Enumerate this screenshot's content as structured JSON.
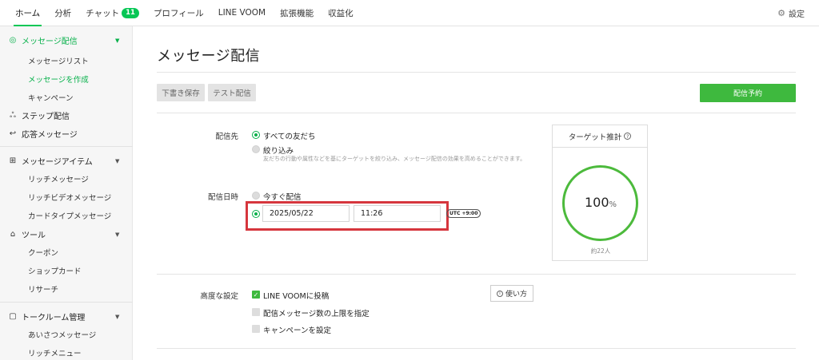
{
  "topnav": {
    "tabs": [
      {
        "label": "ホーム"
      },
      {
        "label": "分析"
      },
      {
        "label": "チャット",
        "badge": "11"
      },
      {
        "label": "プロフィール"
      },
      {
        "label": "LINE VOOM"
      },
      {
        "label": "拡張機能"
      },
      {
        "label": "収益化"
      }
    ],
    "settings_label": "設定"
  },
  "sidebar": {
    "sections": [
      {
        "label": "メッセージ配信",
        "icon": "broadcast-icon"
      },
      {
        "label": "ステップ配信",
        "icon": "step-tree-icon"
      },
      {
        "label": "応答メッセージ",
        "icon": "reply-icon"
      },
      {
        "label": "メッセージアイテム",
        "icon": "plus-box-icon"
      },
      {
        "label": "ツール",
        "icon": "store-icon"
      },
      {
        "label": "トークルーム管理",
        "icon": "chat-room-icon"
      }
    ],
    "subs": {
      "message_list": "メッセージリスト",
      "create_message": "メッセージを作成",
      "campaign": "キャンペーン",
      "rich_message": "リッチメッセージ",
      "rich_video": "リッチビデオメッセージ",
      "card_type": "カードタイプメッセージ",
      "coupon": "クーポン",
      "shop_card": "ショップカード",
      "research": "リサーチ",
      "greeting": "あいさつメッセージ",
      "rich_menu": "リッチメニュー"
    }
  },
  "main": {
    "title": "メッセージ配信",
    "buttons": {
      "save_draft": "下書き保存",
      "test_send": "テスト配信",
      "schedule": "配信予約"
    },
    "recipients": {
      "label": "配信先",
      "all_friends": "すべての友だち",
      "filter": "絞り込み",
      "filter_hint": "友だちの行動や属性などを基にターゲットを絞り込み、メッセージ配信の効果を高めることができます。"
    },
    "schedule": {
      "label": "配信日時",
      "now": "今すぐ配信",
      "date": "2025/05/22",
      "time": "11:26",
      "timezone": "UTC +9:00"
    },
    "target": {
      "title": "ターゲット推計",
      "percent": "100",
      "percent_unit": "%",
      "percent_value": 100,
      "approx": "約22人"
    },
    "advanced": {
      "label": "高度な設定",
      "voom": "LINE VOOMに投稿",
      "limit": "配信メッセージ数の上限を指定",
      "campaign": "キャンペーンを設定",
      "howto": "使い方"
    }
  },
  "colors": {
    "accent": "#06c755",
    "button_green": "#3eb93e",
    "highlight_red": "#d6363d"
  }
}
